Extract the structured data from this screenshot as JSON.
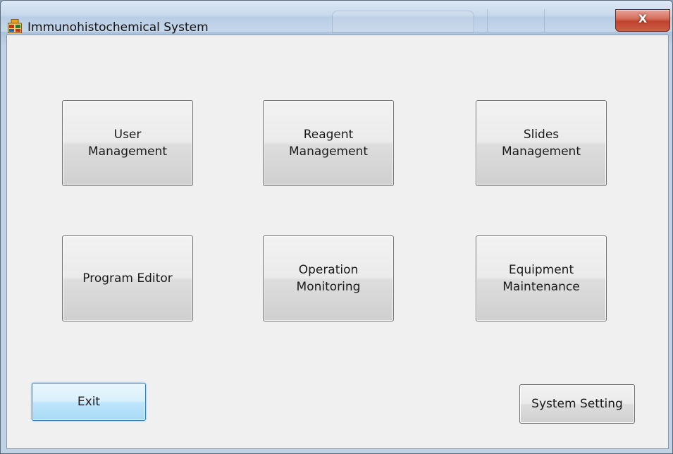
{
  "window": {
    "title": "Immunohistochemical System",
    "close_label": "X",
    "app_icon": "grid-app-icon",
    "close_icon": "close-icon"
  },
  "main": {
    "tiles": [
      {
        "label": "User\nManagement"
      },
      {
        "label": "Reagent\nManagement"
      },
      {
        "label": "Slides\nManagement"
      },
      {
        "label": "Program Editor"
      },
      {
        "label": "Operation\nMonitoring"
      },
      {
        "label": "Equipment\nMaintenance"
      }
    ]
  },
  "footer": {
    "exit_label": "Exit",
    "system_setting_label": "System Setting"
  },
  "colors": {
    "client_bg": "#f0f0f0",
    "focus_button_border": "#3c7fb1",
    "close_button": "#c0432d"
  }
}
